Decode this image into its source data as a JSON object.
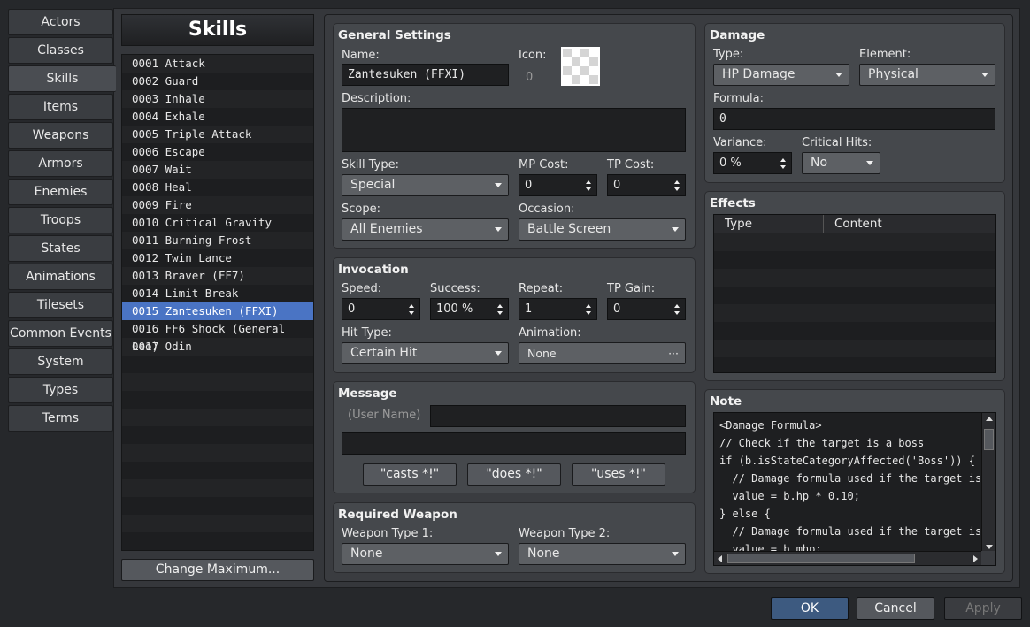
{
  "tabs": [
    "Actors",
    "Classes",
    "Skills",
    "Items",
    "Weapons",
    "Armors",
    "Enemies",
    "Troops",
    "States",
    "Animations",
    "Tilesets",
    "Common Events",
    "System",
    "Types",
    "Terms"
  ],
  "active_tab": "Skills",
  "list": {
    "title": "Skills",
    "items": [
      "0001 Attack",
      "0002 Guard",
      "0003 Inhale",
      "0004 Exhale",
      "0005 Triple Attack",
      "0006 Escape",
      "0007 Wait",
      "0008 Heal",
      "0009 Fire",
      "0010 Critical Gravity",
      "0011 Burning Frost",
      "0012 Twin Lance",
      "0013 Braver (FF7)",
      "0014 Limit Break",
      "0015 Zantesuken (FFXI)",
      "0016 FF6 Shock (General Leo)",
      "0017 Odin"
    ],
    "selected_index": 14,
    "change_max_label": "Change Maximum..."
  },
  "general": {
    "title": "General Settings",
    "name_label": "Name:",
    "name_value": "Zantesuken (FFXI)",
    "icon_label": "Icon:",
    "icon_index": "0",
    "description_label": "Description:",
    "description_value": "",
    "skill_type_label": "Skill Type:",
    "skill_type_value": "Special",
    "mp_cost_label": "MP Cost:",
    "mp_cost_value": "0",
    "tp_cost_label": "TP Cost:",
    "tp_cost_value": "0",
    "scope_label": "Scope:",
    "scope_value": "All Enemies",
    "occasion_label": "Occasion:",
    "occasion_value": "Battle Screen"
  },
  "invocation": {
    "title": "Invocation",
    "speed_label": "Speed:",
    "speed_value": "0",
    "success_label": "Success:",
    "success_value": "100 %",
    "repeat_label": "Repeat:",
    "repeat_value": "1",
    "tp_gain_label": "TP Gain:",
    "tp_gain_value": "0",
    "hit_type_label": "Hit Type:",
    "hit_type_value": "Certain Hit",
    "animation_label": "Animation:",
    "animation_value": "None",
    "animation_more": "···"
  },
  "message": {
    "title": "Message",
    "user_name_label": "(User Name)",
    "line1_value": "",
    "line2_value": "",
    "btn_casts": "\"casts *!\"",
    "btn_does": "\"does *!\"",
    "btn_uses": "\"uses *!\""
  },
  "required_weapon": {
    "title": "Required Weapon",
    "type1_label": "Weapon Type 1:",
    "type1_value": "None",
    "type2_label": "Weapon Type 2:",
    "type2_value": "None"
  },
  "damage": {
    "title": "Damage",
    "type_label": "Type:",
    "type_value": "HP Damage",
    "element_label": "Element:",
    "element_value": "Physical",
    "formula_label": "Formula:",
    "formula_value": "0",
    "variance_label": "Variance:",
    "variance_value": "0 %",
    "critical_label": "Critical Hits:",
    "critical_value": "No"
  },
  "effects": {
    "title": "Effects",
    "col_type": "Type",
    "col_content": "Content"
  },
  "note": {
    "title": "Note",
    "lines": [
      "<Damage Formula>",
      "// Check if the target is a boss",
      "if (b.isStateCategoryAffected('Boss')) {",
      "  // Damage formula used if the target is a",
      "  value = b.hp * 0.10;",
      "} else {",
      "  // Damage formula used if the target isn'",
      "  value = b.mhp;"
    ]
  },
  "footer": {
    "ok": "OK",
    "cancel": "Cancel",
    "apply": "Apply"
  },
  "colors": {
    "selection": "#4a74c4",
    "ok_button": "#3d5a80"
  }
}
